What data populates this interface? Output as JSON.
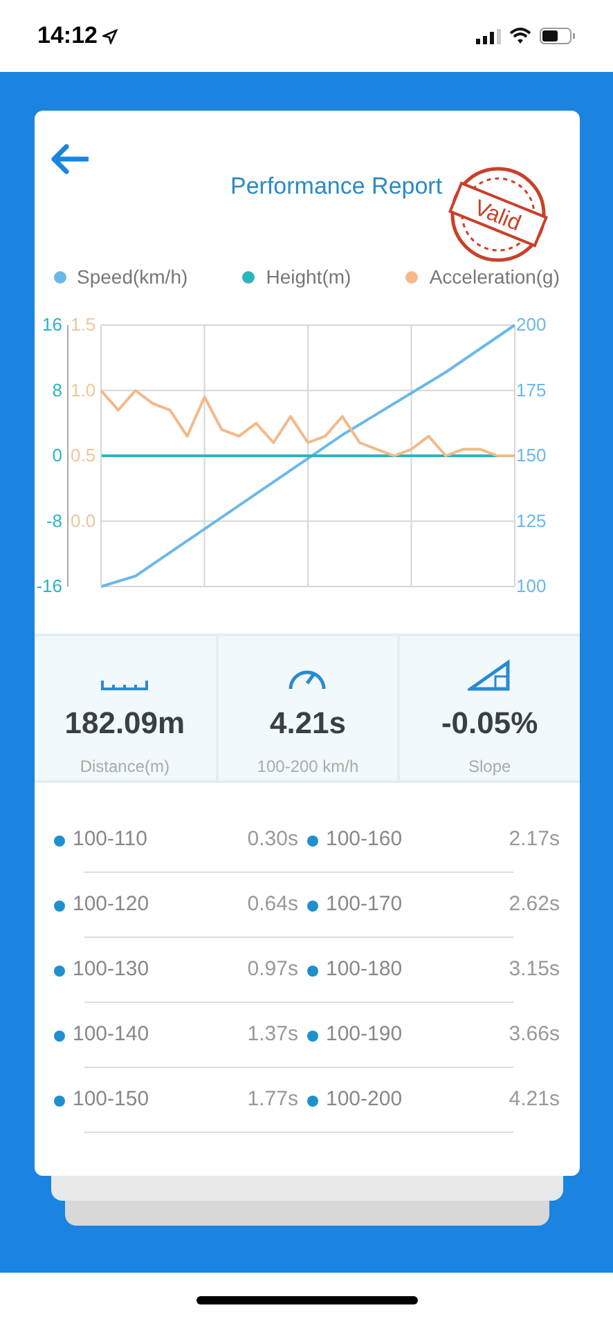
{
  "status_bar": {
    "time": "14:12"
  },
  "header": {
    "title": "Performance Report",
    "stamp": "Valid"
  },
  "chart": {
    "layers": [
      {
        "chart_data": {
          "type": "line",
          "ylim": [
            100,
            200
          ],
          "yticks": [
            200,
            175,
            150,
            125,
            100
          ],
          "grid": true,
          "series": [
            {
              "name": "Speed(km/h)",
              "color": "#6bb8e8",
              "values": [
                100,
                104,
                113,
                122,
                131,
                140,
                149,
                158,
                166,
                174,
                182,
                191,
                200
              ]
            }
          ]
        }
      },
      {
        "chart_data": {
          "type": "line",
          "ylim": [
            -16,
            16
          ],
          "yticks": [
            16,
            8,
            0,
            -8,
            -16
          ],
          "series": [
            {
              "name": "Height(m)",
              "color": "#2bb5bf",
              "values": [
                0,
                0,
                0,
                0,
                0,
                0,
                0,
                0,
                0,
                0,
                0,
                0,
                0
              ]
            }
          ]
        }
      },
      {
        "chart_data": {
          "type": "line",
          "ylim": [
            -0.5,
            1.5
          ],
          "yticks": [
            {
              "value": 1.5,
              "label": "1.5"
            },
            {
              "value": 1,
              "label": "1.0"
            },
            {
              "value": 0.5,
              "label": "0.5"
            },
            {
              "value": 0,
              "label": "0.0"
            }
          ],
          "series": [
            {
              "name": "Acceleration(g)",
              "color": "#f3b98a",
              "values": [
                1.0,
                0.85,
                1.0,
                0.9,
                0.85,
                0.65,
                0.95,
                0.7,
                0.65,
                0.75,
                0.6,
                0.8,
                0.6,
                0.65,
                0.8,
                0.6,
                0.55,
                0.5,
                0.55,
                0.65,
                0.5,
                0.55,
                0.55,
                0.5,
                0.5
              ]
            }
          ]
        }
      }
    ]
  },
  "stats": [
    {
      "kind": "distance",
      "value": "182.09m",
      "label": "Distance(m)"
    },
    {
      "kind": "time",
      "value": "4.21s",
      "label": "100-200 km/h"
    },
    {
      "kind": "slope",
      "value": "-0.05%",
      "label": "Slope"
    }
  ],
  "splits": [
    {
      "range": "100-110",
      "time": "0.30s"
    },
    {
      "range": "100-160",
      "time": "2.17s"
    },
    {
      "range": "100-120",
      "time": "0.64s"
    },
    {
      "range": "100-170",
      "time": "2.62s"
    },
    {
      "range": "100-130",
      "time": "0.97s"
    },
    {
      "range": "100-180",
      "time": "3.15s"
    },
    {
      "range": "100-140",
      "time": "1.37s"
    },
    {
      "range": "100-190",
      "time": "3.66s"
    },
    {
      "range": "100-150",
      "time": "1.77s"
    },
    {
      "range": "100-200",
      "time": "4.21s"
    }
  ]
}
